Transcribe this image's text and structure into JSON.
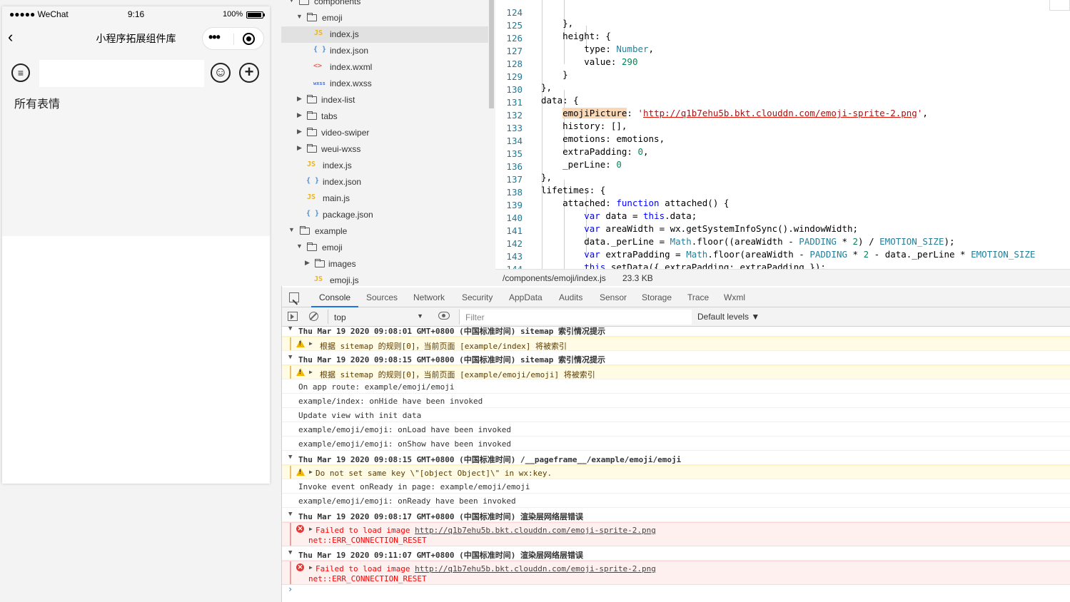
{
  "simulator": {
    "status_bar": {
      "carrier": "●●●●● WeChat",
      "time": "9:16",
      "battery": "100%"
    },
    "nav": {
      "title": "小程序拓展组件库",
      "back_icon": "chevron-left-icon",
      "more_glyph": "•••"
    },
    "toolbar": {
      "list_icon": "list-icon",
      "emoji_icon": "smiley-icon",
      "add_icon": "plus-circle-icon",
      "input_value": ""
    },
    "section_title": "所有表情"
  },
  "file_tree": {
    "items": [
      {
        "label": "components",
        "type": "folder",
        "arrow": "▼"
      },
      {
        "label": "emoji",
        "type": "folder",
        "arrow": "▼"
      },
      {
        "label": "index.js",
        "type": "js",
        "icon": "JS"
      },
      {
        "label": "index.json",
        "type": "json",
        "icon": "{ }"
      },
      {
        "label": "index.wxml",
        "type": "wxml",
        "icon": "<>"
      },
      {
        "label": "index.wxss",
        "type": "wxss",
        "icon": "wxss"
      },
      {
        "label": "index-list",
        "type": "folder",
        "arrow": "▶"
      },
      {
        "label": "tabs",
        "type": "folder",
        "arrow": "▶"
      },
      {
        "label": "video-swiper",
        "type": "folder",
        "arrow": "▶"
      },
      {
        "label": "weui-wxss",
        "type": "folder",
        "arrow": "▶"
      },
      {
        "label": "index.js",
        "type": "js",
        "icon": "JS"
      },
      {
        "label": "index.json",
        "type": "json",
        "icon": "{ }"
      },
      {
        "label": "main.js",
        "type": "js",
        "icon": "JS"
      },
      {
        "label": "package.json",
        "type": "json",
        "icon": "{ }"
      },
      {
        "label": "example",
        "type": "folder",
        "arrow": "▼"
      },
      {
        "label": "emoji",
        "type": "folder",
        "arrow": "▼"
      },
      {
        "label": "images",
        "type": "folder",
        "arrow": "▶"
      },
      {
        "label": "emoji.js",
        "type": "js",
        "icon": "JS"
      }
    ]
  },
  "editor": {
    "line_numbers": [
      "124",
      "125",
      "126",
      "127",
      "128",
      "129",
      "130",
      "131",
      "132",
      "133",
      "134",
      "135",
      "136",
      "137",
      "138",
      "139",
      "140",
      "141",
      "142",
      "143",
      "144"
    ],
    "code": {
      "l124": "    },",
      "l125a": "    height",
      "l125b": ": {",
      "l126a": "        type",
      "l126b": ": ",
      "l126c": "Number",
      "l126d": ",",
      "l127a": "        value",
      "l127b": ": ",
      "l127c": "290",
      "l128": "    }",
      "l129": "},",
      "l130": "data: {",
      "l131a": "    ",
      "l131b": "emojiPicture",
      "l131c": ": ",
      "l131d": "'",
      "l131e": "http://q1b7ehu5b.bkt.clouddn.com/emoji-sprite-2.png",
      "l131f": "'",
      "l131g": ",",
      "l132": "    history: [],",
      "l133": "    emotions: emotions,",
      "l134a": "    extraPadding: ",
      "l134b": "0",
      "l134c": ",",
      "l135a": "    _perLine: ",
      "l135b": "0",
      "l136": "},",
      "l137": "lifetimes: {",
      "l138a": "    attached: ",
      "l138b": "function",
      "l138c": " attached() {",
      "l139a": "        ",
      "l139b": "var",
      "l139c": " data = ",
      "l139d": "this",
      "l139e": ".data;",
      "l140a": "        ",
      "l140b": "var",
      "l140c": " areaWidth = wx.getSystemInfoSync().windowWidth;",
      "l141a": "        data._perLine = ",
      "l141b": "Math",
      "l141c": ".floor((areaWidth - ",
      "l141d": "PADDING",
      "l141e": " * ",
      "l141f": "2",
      "l141g": ") / ",
      "l141h": "EMOTION_SIZE",
      "l141i": ");",
      "l142a": "        ",
      "l142b": "var",
      "l142c": " extraPadding = ",
      "l142d": "Math",
      "l142e": ".floor(areaWidth - ",
      "l142f": "PADDING",
      "l142g": " * ",
      "l142h": "2",
      "l142i": " - data._perLine * ",
      "l142j": "EMOTION_SIZE",
      "l143a": "        ",
      "l143b": "this",
      "l143c": ".setData({ extraPadding: extraPadding });",
      "l144": "    }"
    },
    "status": {
      "path": "/components/emoji/index.js",
      "size": "23.3 KB"
    }
  },
  "devtools": {
    "tabs": [
      "Console",
      "Sources",
      "Network",
      "Security",
      "AppData",
      "Audits",
      "Sensor",
      "Storage",
      "Trace",
      "Wxml"
    ],
    "active_tab": "Console",
    "context": "top",
    "filter_placeholder": "Filter",
    "levels": "Default levels ▼",
    "console": {
      "g1": "Thu Mar 19 2020 09:08:01 GMT+0800 (中国标准时间) sitemap 索引情况提示",
      "w1": "根据 sitemap 的规则[0]，当前页面 [example/index] 将被索引",
      "g2": "Thu Mar 19 2020 09:08:15 GMT+0800 (中国标准时间) sitemap 索引情况提示",
      "w2": "根据 sitemap 的规则[0]，当前页面 [example/emoji/emoji] 将被索引",
      "l1": "On app route: example/emoji/emoji",
      "l2": "example/index: onHide have been invoked",
      "l3": "Update view with init data",
      "l4": "example/emoji/emoji: onLoad have been invoked",
      "l5": "example/emoji/emoji: onShow have been invoked",
      "g3": "Thu Mar 19 2020 09:08:15 GMT+0800 (中国标准时间) /__pageframe__/example/emoji/emoji",
      "w3": "Do not set same key \\\"[object Object]\\\" in wx:key.",
      "l6": "Invoke event onReady in page: example/emoji/emoji",
      "l7": "example/emoji/emoji: onReady have been invoked",
      "g4": "Thu Mar 19 2020 09:08:17 GMT+0800 (中国标准时间) 渲染层网络层错误",
      "e1a": "Failed to load image ",
      "e1b": "http://q1b7ehu5b.bkt.clouddn.com/emoji-sprite-2.png",
      "e1c": "net::ERR_CONNECTION_RESET",
      "g5": "Thu Mar 19 2020 09:11:07 GMT+0800 (中国标准时间) 渲染层网络层错误",
      "e2a": "Failed to load image ",
      "e2b": "http://q1b7ehu5b.bkt.clouddn.com/emoji-sprite-2.png",
      "e2c": "net::ERR_CONNECTION_RESET",
      "prompt": "›"
    }
  },
  "colors": {
    "accent": "#1a73e8",
    "js_icon": "#e9b227",
    "json_icon": "#4b8ed6",
    "wxml_icon": "#e8675a",
    "warning_bg": "#fffbe5",
    "error_bg": "#fff0f0",
    "error_text": "#ff0000"
  }
}
